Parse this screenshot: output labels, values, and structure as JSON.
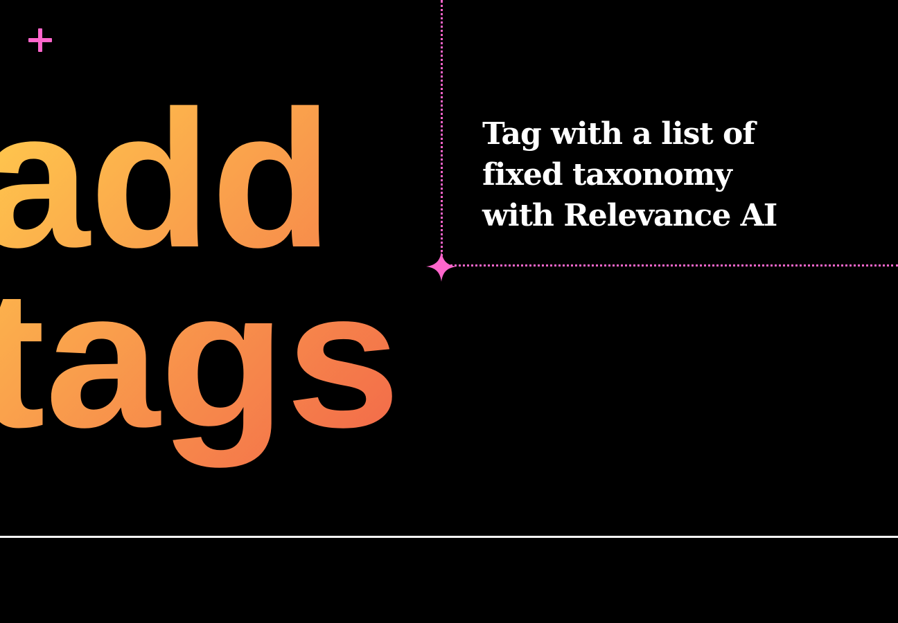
{
  "hero": {
    "line1": "add",
    "line2": "tags",
    "gradient_start": "#ffc94d",
    "gradient_end": "#f2684a"
  },
  "tagline": {
    "lines": [
      "Tag with a list of",
      "fixed taxonomy",
      "with Relevance AI"
    ]
  },
  "accent_color": "#ff66cc",
  "icons": {
    "plus": "plus-icon",
    "spark": "four-point-star-icon"
  }
}
